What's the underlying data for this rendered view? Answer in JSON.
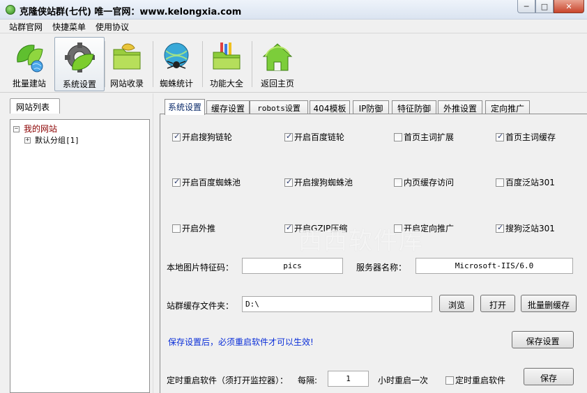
{
  "window": {
    "title": "克隆侠站群(七代)  唯一官网：www.kelongxia.com",
    "min_label": "─",
    "max_label": "□",
    "close_label": "✕"
  },
  "menu": [
    "站群官网",
    "快捷菜单",
    "使用协议"
  ],
  "toolbar": [
    {
      "label": "批量建站",
      "icon": "leaf-globe-icon"
    },
    {
      "label": "系统设置",
      "icon": "gear-leaf-icon"
    },
    {
      "label": "网站收录",
      "icon": "folder-leaf-icon"
    },
    {
      "label": "蜘蛛统计",
      "icon": "spider-globe-icon"
    },
    {
      "label": "功能大全",
      "icon": "folder-pencils-icon"
    },
    {
      "label": "返回主页",
      "icon": "home-icon"
    }
  ],
  "left_panel": {
    "tab": "网站列表",
    "tree": {
      "root": "我的网站",
      "root_expander": "⊟",
      "child": "默认分组[1]",
      "child_expander": "+"
    }
  },
  "tabs": [
    "系统设置",
    "缓存设置",
    "robots设置",
    "404模板",
    "IP防御",
    "特征防御",
    "外推设置",
    "定向推广"
  ],
  "checkboxes": [
    {
      "label": "开启搜狗链轮",
      "checked": true
    },
    {
      "label": "开启百度链轮",
      "checked": true
    },
    {
      "label": "首页主词扩展",
      "checked": false
    },
    {
      "label": "首页主词缓存",
      "checked": true
    },
    {
      "label": "开启百度蜘蛛池",
      "checked": true
    },
    {
      "label": "开启搜狗蜘蛛池",
      "checked": true
    },
    {
      "label": "内页缓存访问",
      "checked": false
    },
    {
      "label": "百度泛站301",
      "checked": false
    },
    {
      "label": "开启外推",
      "checked": false
    },
    {
      "label": "开启GZIP压缩",
      "checked": true
    },
    {
      "label": "开启定向推广",
      "checked": false
    },
    {
      "label": "搜狗泛站301",
      "checked": true
    }
  ],
  "fields": {
    "image_code_label": "本地图片特征码：",
    "image_code_value": "pics",
    "server_name_label": "服务器名称：",
    "server_name_value": "Microsoft-IIS/6.0",
    "cache_folder_label": "站群缓存文件夹：",
    "cache_folder_value": "D:\\"
  },
  "buttons": {
    "browse": "浏览",
    "open": "打开",
    "batch_delete_cache": "批量删缓存",
    "save_settings": "保存设置",
    "save": "保存"
  },
  "notice": "保存设置后，必须重启软件才可以生效!",
  "restart": {
    "label": "定时重启软件（须打开监控器）：",
    "interval_label": "每隔:",
    "interval_value": "1",
    "unit_label": "小时重启一次",
    "checkbox_label": "定时重启软件",
    "checked": false
  },
  "watermark": "西西软件库",
  "colors": {
    "notice": "#0a2ed8",
    "tree_root": "#8b0000",
    "active_tab_text": "#0a2a6a"
  }
}
